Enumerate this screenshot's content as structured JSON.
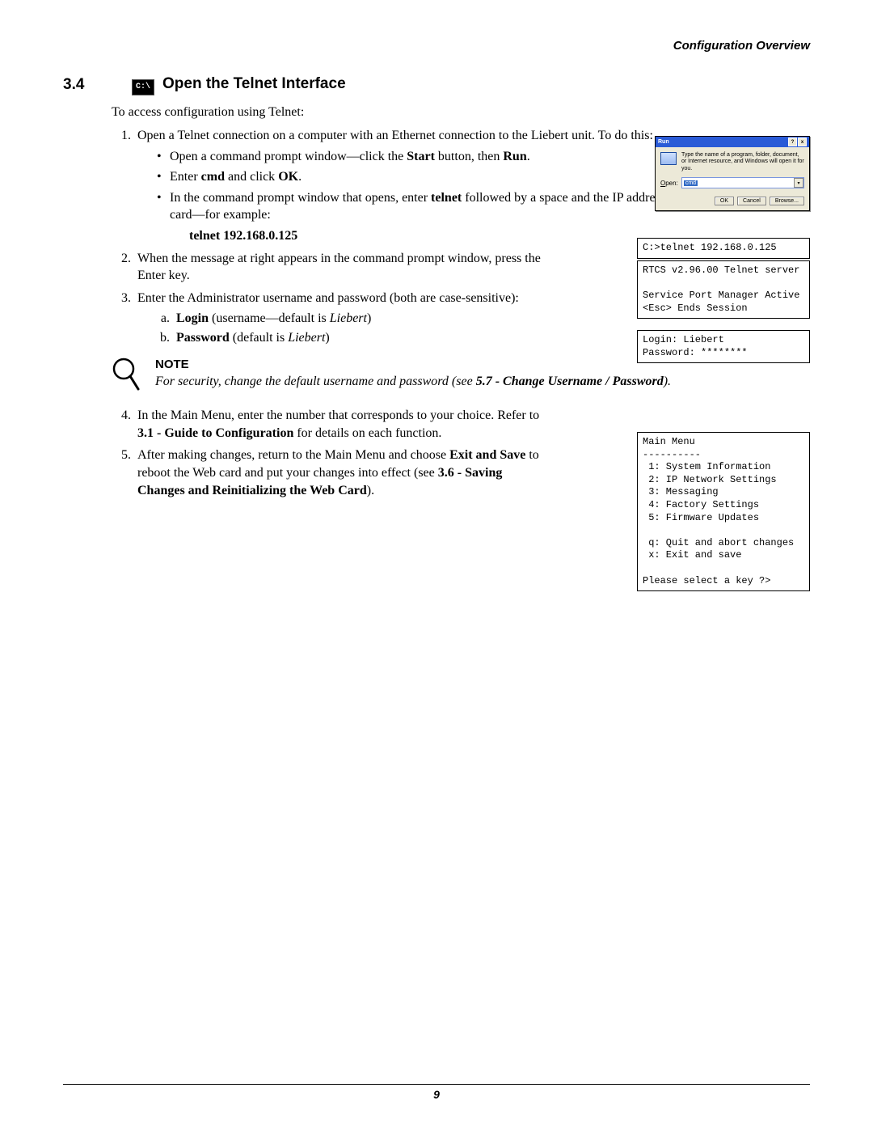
{
  "running_head": "Configuration Overview",
  "section": {
    "number": "3.4",
    "badge": "C:\\",
    "title": "Open the Telnet Interface"
  },
  "intro": "To access configuration using Telnet:",
  "step1_lead": "Open a Telnet connection on a computer with an Ethernet connection to the Liebert unit. To do this:",
  "step1_bullets": {
    "b1_pre": "Open a command prompt window—click the ",
    "b1_start": "Start",
    "b1_mid": " button, then ",
    "b1_run": "Run",
    "b1_post": ".",
    "b2_pre": "Enter ",
    "b2_cmd": "cmd",
    "b2_mid": " and click ",
    "b2_ok": "OK",
    "b2_post": ".",
    "b3_pre": "In the command prompt window that opens, enter ",
    "b3_telnet": "telnet",
    "b3_post": " followed by a space and the IP address or hostname of the Web card—for example:"
  },
  "telnet_example": "telnet 192.168.0.125",
  "step2": "When the message at right appears in the command prompt window, press the Enter key.",
  "step3": "Enter the Administrator username and password (both are case-sensitive):",
  "step3_items": {
    "a_pre": "",
    "a_login": "Login",
    "a_mid": " (username—default is ",
    "a_def": "Liebert",
    "a_post": ")",
    "b_pw": "Password",
    "b_mid": " (default is ",
    "b_def": "Liebert",
    "b_post": ")"
  },
  "note": {
    "title": "NOTE",
    "text_pre": "For security, change the default username and password (see ",
    "text_ref": "5.7 - Change Username / Password",
    "text_post": ")."
  },
  "step4_pre": "In the Main Menu, enter the number that corresponds to your choice. Refer to ",
  "step4_ref": "3.1 - Guide to Configuration",
  "step4_post": " for details on each function.",
  "step5_pre": "After making changes, return to the Main Menu and choose ",
  "step5_exit": "Exit and Save",
  "step5_mid": " to reboot the Web card and put your changes into effect (see ",
  "step5_ref": "3.6 - Saving Changes and Reinitializing the Web Card",
  "step5_post": ").",
  "run_dialog": {
    "title": "Run",
    "desc": "Type the name of a program, folder, document, or Internet resource, and Windows will open it for you.",
    "open_label": "Open:",
    "open_value": "cmd",
    "btn_ok": "OK",
    "btn_cancel": "Cancel",
    "btn_browse": "Browse...",
    "help": "?",
    "close": "x"
  },
  "codebox1": "C:>telnet 192.168.0.125",
  "codebox2": "RTCS v2.96.00 Telnet server\n\nService Port Manager Active\n<Esc> Ends Session",
  "codebox3": "Login: Liebert\nPassword: ********",
  "codebox4": "Main Menu\n----------\n 1: System Information\n 2: IP Network Settings\n 3: Messaging\n 4: Factory Settings\n 5: Firmware Updates\n\n q: Quit and abort changes\n x: Exit and save\n\nPlease select a key ?>",
  "page_number": "9"
}
